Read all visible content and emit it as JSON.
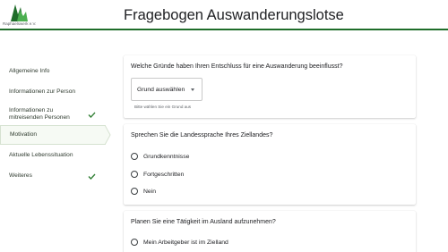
{
  "header": {
    "logo_text": "Raphaelswerk e.V.",
    "title": "Fragebogen Auswanderungslotse"
  },
  "colors": {
    "brand_green": "#1f6d2a",
    "check_green": "#2e7d32",
    "active_bg": "#f6faf4"
  },
  "sidebar": {
    "items": [
      {
        "label": "Allgemeine Info",
        "completed": false,
        "active": false
      },
      {
        "label": "Informationen zur Person",
        "completed": false,
        "active": false
      },
      {
        "label": "Informationen zu mitreisenden Personen",
        "completed": true,
        "active": false
      },
      {
        "label": "Motivation",
        "completed": false,
        "active": true
      },
      {
        "label": "Aktuelle Lebenssituation",
        "completed": false,
        "active": false
      },
      {
        "label": "Weiteres",
        "completed": true,
        "active": false
      }
    ]
  },
  "main": {
    "q1": {
      "question": "Welche Gründe haben Ihren Entschluss für eine Auswanderung beeinflusst?",
      "select_value": "Grund auswählen",
      "helper": "Bitte wählen Sie ein Grund aus"
    },
    "q2": {
      "question": "Sprechen Sie die Landessprache Ihres Ziellandes?",
      "options": [
        "Grundkenntnisse",
        "Fortgeschritten",
        "Nein"
      ]
    },
    "q3": {
      "question": "Planen Sie eine Tätigkeit im Ausland aufzunehmen?",
      "options": [
        "Mein Arbeitgeber ist im Zielland"
      ]
    }
  }
}
